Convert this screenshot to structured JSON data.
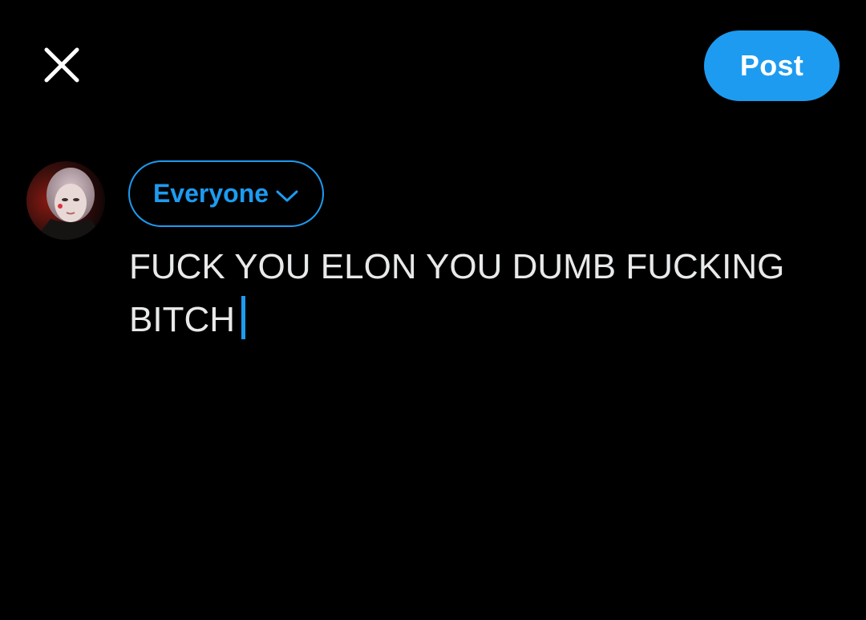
{
  "header": {
    "close_icon": "close-icon",
    "post_label": "Post"
  },
  "composer": {
    "avatar_icon": "user-avatar",
    "audience_label": "Everyone",
    "audience_icon": "chevron-down-icon",
    "text": "FUCK YOU ELON YOU DUMB FUCKING BITCH"
  },
  "colors": {
    "background": "#000000",
    "accent": "#1d9bf0",
    "text": "#e7e9ea"
  }
}
